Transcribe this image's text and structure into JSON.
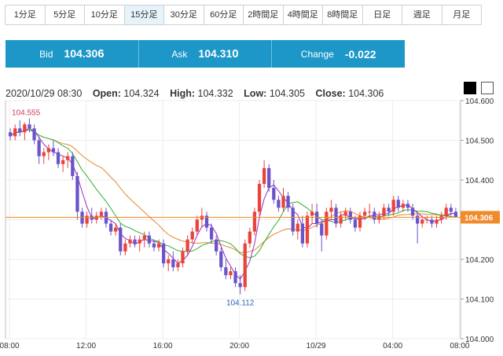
{
  "tabs": [
    {
      "label": "1分足",
      "active": false
    },
    {
      "label": "5分足",
      "active": false
    },
    {
      "label": "10分足",
      "active": false
    },
    {
      "label": "15分足",
      "active": true
    },
    {
      "label": "30分足",
      "active": false
    },
    {
      "label": "60分足",
      "active": false
    },
    {
      "label": "2時間足",
      "active": false
    },
    {
      "label": "4時間足",
      "active": false
    },
    {
      "label": "8時間足",
      "active": false
    },
    {
      "label": "日足",
      "active": false
    },
    {
      "label": "週足",
      "active": false
    },
    {
      "label": "月足",
      "active": false
    }
  ],
  "quote": {
    "bid_label": "Bid",
    "bid_main": "104.30",
    "bid_pip": "6",
    "ask_label": "Ask",
    "ask_main": "104.31",
    "ask_pip": "0",
    "change_label": "Change",
    "change_value": "-0.022"
  },
  "ohlc": {
    "datetime": "2020/10/29 08:30",
    "open_label": "Open:",
    "open": "104.324",
    "high_label": "High:",
    "high": "104.332",
    "low_label": "Low:",
    "low": "104.305",
    "close_label": "Close:",
    "close": "104.306"
  },
  "colors": {
    "up": "#e8443a",
    "down": "#6a54c9",
    "ma_short": "#9b2fc2",
    "ma_mid": "#2fae2f",
    "ma_long": "#e6862a",
    "current_price_bg": "#f08a2c",
    "quote_bg": "#1c97c8"
  },
  "chart_data": {
    "type": "candlestick",
    "y_ticks": [
      "104.600",
      "104.500",
      "104.400",
      "104.300",
      "104.200",
      "104.100",
      "104.000"
    ],
    "ylim": [
      104.0,
      104.6
    ],
    "x_ticks": [
      "08:00",
      "12:00",
      "16:00",
      "20:00",
      "10/29",
      "04:00",
      "08:00"
    ],
    "current_price": "104.306",
    "high_label": "104.555",
    "low_label": "104.112",
    "candles": [
      [
        104.52,
        104.53,
        104.5,
        104.51
      ],
      [
        104.51,
        104.54,
        104.5,
        104.53
      ],
      [
        104.53,
        104.55,
        104.51,
        104.52
      ],
      [
        104.52,
        104.545,
        104.5,
        104.54
      ],
      [
        104.54,
        104.555,
        104.52,
        104.53
      ],
      [
        104.53,
        104.54,
        104.49,
        104.5
      ],
      [
        104.5,
        104.51,
        104.44,
        104.46
      ],
      [
        104.46,
        104.48,
        104.44,
        104.47
      ],
      [
        104.47,
        104.49,
        104.45,
        104.48
      ],
      [
        104.48,
        104.5,
        104.46,
        104.47
      ],
      [
        104.47,
        104.48,
        104.43,
        104.44
      ],
      [
        104.44,
        104.46,
        104.42,
        104.45
      ],
      [
        104.45,
        104.47,
        104.43,
        104.46
      ],
      [
        104.46,
        104.47,
        104.4,
        104.41
      ],
      [
        104.41,
        104.42,
        104.3,
        104.32
      ],
      [
        104.32,
        104.33,
        104.28,
        104.29
      ],
      [
        104.29,
        104.32,
        104.28,
        104.31
      ],
      [
        104.31,
        104.33,
        104.29,
        104.3
      ],
      [
        104.3,
        104.32,
        104.29,
        104.31
      ],
      [
        104.31,
        104.33,
        104.3,
        104.32
      ],
      [
        104.32,
        104.33,
        104.28,
        104.29
      ],
      [
        104.29,
        104.3,
        104.26,
        104.27
      ],
      [
        104.27,
        104.29,
        104.26,
        104.28
      ],
      [
        104.28,
        104.29,
        104.21,
        104.22
      ],
      [
        104.22,
        104.25,
        104.21,
        104.24
      ],
      [
        104.24,
        104.26,
        104.23,
        104.25
      ],
      [
        104.25,
        104.26,
        104.23,
        104.24
      ],
      [
        104.24,
        104.26,
        104.22,
        104.25
      ],
      [
        104.25,
        104.27,
        104.23,
        104.26
      ],
      [
        104.26,
        104.27,
        104.23,
        104.24
      ],
      [
        104.24,
        104.25,
        104.22,
        104.23
      ],
      [
        104.23,
        104.25,
        104.22,
        104.24
      ],
      [
        104.24,
        104.25,
        104.18,
        104.19
      ],
      [
        104.19,
        104.21,
        104.17,
        104.2
      ],
      [
        104.2,
        104.22,
        104.17,
        104.18
      ],
      [
        104.18,
        104.2,
        104.17,
        104.19
      ],
      [
        104.19,
        104.23,
        104.18,
        104.22
      ],
      [
        104.22,
        104.26,
        104.21,
        104.25
      ],
      [
        104.25,
        104.28,
        104.24,
        104.27
      ],
      [
        104.27,
        104.31,
        104.26,
        104.3
      ],
      [
        104.3,
        104.33,
        104.28,
        104.31
      ],
      [
        104.31,
        104.32,
        104.27,
        104.28
      ],
      [
        104.28,
        104.29,
        104.24,
        104.25
      ],
      [
        104.25,
        104.26,
        104.21,
        104.22
      ],
      [
        104.22,
        104.23,
        104.17,
        104.18
      ],
      [
        104.18,
        104.2,
        104.15,
        104.16
      ],
      [
        104.16,
        104.18,
        104.15,
        104.17
      ],
      [
        104.17,
        104.18,
        104.13,
        104.14
      ],
      [
        104.14,
        104.16,
        104.112,
        104.13
      ],
      [
        104.13,
        104.25,
        104.12,
        104.24
      ],
      [
        104.24,
        104.28,
        104.23,
        104.27
      ],
      [
        104.27,
        104.33,
        104.26,
        104.32
      ],
      [
        104.32,
        104.4,
        104.31,
        104.39
      ],
      [
        104.39,
        104.45,
        104.38,
        104.43
      ],
      [
        104.43,
        104.44,
        104.37,
        104.38
      ],
      [
        104.38,
        104.4,
        104.34,
        104.35
      ],
      [
        104.35,
        104.36,
        104.32,
        104.33
      ],
      [
        104.33,
        104.38,
        104.32,
        104.36
      ],
      [
        104.36,
        104.37,
        104.32,
        104.33
      ],
      [
        104.33,
        104.34,
        104.26,
        104.27
      ],
      [
        104.27,
        104.3,
        104.25,
        104.29
      ],
      [
        104.29,
        104.31,
        104.23,
        104.24
      ],
      [
        104.24,
        104.32,
        104.23,
        104.31
      ],
      [
        104.31,
        104.34,
        104.29,
        104.32
      ],
      [
        104.32,
        104.34,
        104.28,
        104.29
      ],
      [
        104.29,
        104.3,
        104.22,
        104.26
      ],
      [
        104.26,
        104.33,
        104.25,
        104.32
      ],
      [
        104.32,
        104.35,
        104.3,
        104.33
      ],
      [
        104.33,
        104.34,
        104.28,
        104.29
      ],
      [
        104.29,
        104.32,
        104.28,
        104.31
      ],
      [
        104.31,
        104.33,
        104.3,
        104.32
      ],
      [
        104.32,
        104.33,
        104.29,
        104.3
      ],
      [
        104.3,
        104.31,
        104.27,
        104.28
      ],
      [
        104.28,
        104.32,
        104.27,
        104.31
      ],
      [
        104.31,
        104.33,
        104.3,
        104.32
      ],
      [
        104.32,
        104.34,
        104.31,
        104.32
      ],
      [
        104.32,
        104.33,
        104.29,
        104.3
      ],
      [
        104.3,
        104.32,
        104.29,
        104.31
      ],
      [
        104.31,
        104.34,
        104.3,
        104.33
      ],
      [
        104.33,
        104.34,
        104.31,
        104.32
      ],
      [
        104.32,
        104.36,
        104.31,
        104.35
      ],
      [
        104.35,
        104.36,
        104.32,
        104.33
      ],
      [
        104.33,
        104.35,
        104.32,
        104.34
      ],
      [
        104.34,
        104.35,
        104.32,
        104.33
      ],
      [
        104.33,
        104.34,
        104.3,
        104.31
      ],
      [
        104.31,
        104.32,
        104.24,
        104.29
      ],
      [
        104.29,
        104.31,
        104.28,
        104.3
      ],
      [
        104.3,
        104.31,
        104.29,
        104.3
      ],
      [
        104.3,
        104.31,
        104.28,
        104.29
      ],
      [
        104.29,
        104.31,
        104.28,
        104.3
      ],
      [
        104.3,
        104.32,
        104.29,
        104.31
      ],
      [
        104.31,
        104.34,
        104.3,
        104.33
      ],
      [
        104.33,
        104.34,
        104.31,
        104.32
      ],
      [
        104.32,
        104.33,
        104.305,
        104.306
      ]
    ]
  }
}
